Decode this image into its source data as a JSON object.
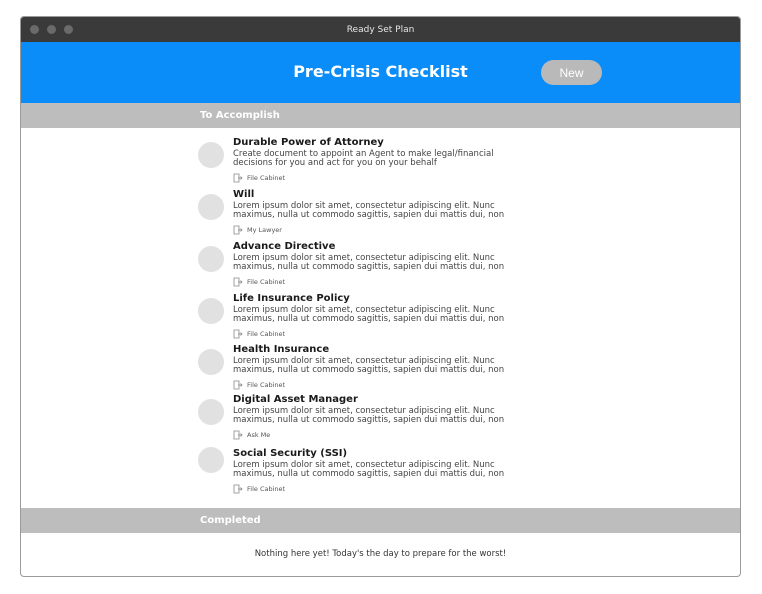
{
  "window": {
    "title": "Ready Set Plan"
  },
  "header": {
    "title": "Pre-Crisis Checklist",
    "new_label": "New"
  },
  "sections": {
    "todo": "To Accomplish",
    "completed": "Completed"
  },
  "items": [
    {
      "title": "Durable Power of Attorney",
      "desc": "Create document to appoint an Agent to make legal/financial decisions for you and act for you on your behalf",
      "location": "File Cabinet"
    },
    {
      "title": "Will",
      "desc": "Lorem ipsum dolor sit amet, consectetur adipiscing elit. Nunc maximus, nulla ut commodo sagittis, sapien dui mattis dui, non",
      "location": "My Lawyer"
    },
    {
      "title": "Advance Directive",
      "desc": "Lorem ipsum dolor sit amet, consectetur adipiscing elit. Nunc maximus, nulla ut commodo sagittis, sapien dui mattis dui, non",
      "location": "File Cabinet"
    },
    {
      "title": "Life Insurance Policy",
      "desc": "Lorem ipsum dolor sit amet, consectetur adipiscing elit. Nunc maximus, nulla ut commodo sagittis, sapien dui mattis dui, non",
      "location": "File Cabinet"
    },
    {
      "title": "Health Insurance",
      "desc": "Lorem ipsum dolor sit amet, consectetur adipiscing elit. Nunc maximus, nulla ut commodo sagittis, sapien dui mattis dui, non",
      "location": "File Cabinet"
    },
    {
      "title": "Digital Asset Manager",
      "desc": "Lorem ipsum dolor sit amet, consectetur adipiscing elit. Nunc maximus, nulla ut commodo sagittis, sapien dui mattis dui, non",
      "location": "Ask Me"
    },
    {
      "title": "Social Security (SSI)",
      "desc": "Lorem ipsum dolor sit amet, consectetur adipiscing elit. Nunc maximus, nulla ut commodo sagittis, sapien dui mattis dui, non",
      "location": "File Cabinet"
    }
  ],
  "completed": {
    "empty_message": "Nothing here yet! Today's the day to prepare for the worst!"
  },
  "colors": {
    "header": "#0a8df8",
    "section_bar": "#bdbdbd",
    "titlebar": "#3a3a3a",
    "button": "#b9b9b9"
  },
  "icons": {
    "location": "document-arrow-icon"
  }
}
